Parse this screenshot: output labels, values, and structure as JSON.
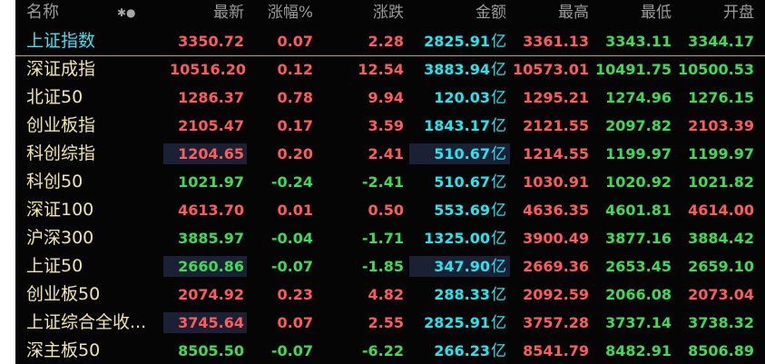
{
  "header": {
    "name": "名称",
    "latest": "最新",
    "pct": "涨幅%",
    "chg": "涨跌",
    "amount": "金额",
    "high": "最高",
    "low": "最低",
    "open": "开盘",
    "settings_icon": "✱●"
  },
  "amount_unit": "亿",
  "colors": {
    "up": "#ff5b5b",
    "down": "#3ddc55",
    "amount": "#1ee8f0",
    "name": "#f1e6a6",
    "selected_name": "#3fe0ef"
  },
  "rows": [
    {
      "name": "上证指数",
      "latest": "3350.72",
      "pct": "0.07",
      "chg": "2.28",
      "amount": "2825.91",
      "high": "3361.13",
      "low": "3343.11",
      "open": "3344.17",
      "c": {
        "latest": "red",
        "pct": "red",
        "chg": "red",
        "high": "red",
        "low": "green",
        "open": "green"
      },
      "hl_latest": false,
      "hl_amt": false,
      "selected": true
    },
    {
      "name": "深证成指",
      "latest": "10516.20",
      "pct": "0.12",
      "chg": "12.54",
      "amount": "3883.94",
      "high": "10573.01",
      "low": "10491.75",
      "open": "10500.53",
      "c": {
        "latest": "red",
        "pct": "red",
        "chg": "red",
        "high": "red",
        "low": "green",
        "open": "green"
      },
      "hl_latest": false,
      "hl_amt": false,
      "selected": false
    },
    {
      "name": "北证50",
      "latest": "1286.37",
      "pct": "0.78",
      "chg": "9.94",
      "amount": "120.03",
      "high": "1295.21",
      "low": "1274.96",
      "open": "1276.15",
      "c": {
        "latest": "red",
        "pct": "red",
        "chg": "red",
        "high": "red",
        "low": "green",
        "open": "green"
      },
      "hl_latest": false,
      "hl_amt": false,
      "selected": false
    },
    {
      "name": "创业板指",
      "latest": "2105.47",
      "pct": "0.17",
      "chg": "3.59",
      "amount": "1843.17",
      "high": "2121.55",
      "low": "2097.82",
      "open": "2103.39",
      "c": {
        "latest": "red",
        "pct": "red",
        "chg": "red",
        "high": "red",
        "low": "green",
        "open": "red"
      },
      "hl_latest": false,
      "hl_amt": false,
      "selected": false
    },
    {
      "name": "科创综指",
      "latest": "1204.65",
      "pct": "0.20",
      "chg": "2.41",
      "amount": "510.67",
      "high": "1214.55",
      "low": "1199.97",
      "open": "1199.97",
      "c": {
        "latest": "red",
        "pct": "red",
        "chg": "red",
        "high": "red",
        "low": "green",
        "open": "green"
      },
      "hl_latest": true,
      "hl_amt": true,
      "selected": false
    },
    {
      "name": "科创50",
      "latest": "1021.97",
      "pct": "-0.24",
      "chg": "-2.41",
      "amount": "510.67",
      "high": "1030.91",
      "low": "1020.92",
      "open": "1021.82",
      "c": {
        "latest": "green",
        "pct": "green",
        "chg": "green",
        "high": "red",
        "low": "green",
        "open": "green"
      },
      "hl_latest": false,
      "hl_amt": false,
      "selected": false
    },
    {
      "name": "深证100",
      "latest": "4613.70",
      "pct": "0.01",
      "chg": "0.50",
      "amount": "553.69",
      "high": "4636.35",
      "low": "4601.81",
      "open": "4614.00",
      "c": {
        "latest": "red",
        "pct": "red",
        "chg": "red",
        "high": "red",
        "low": "green",
        "open": "red"
      },
      "hl_latest": false,
      "hl_amt": false,
      "selected": false
    },
    {
      "name": "沪深300",
      "latest": "3885.97",
      "pct": "-0.04",
      "chg": "-1.71",
      "amount": "1325.00",
      "high": "3900.49",
      "low": "3877.16",
      "open": "3884.42",
      "c": {
        "latest": "green",
        "pct": "green",
        "chg": "green",
        "high": "red",
        "low": "green",
        "open": "green"
      },
      "hl_latest": false,
      "hl_amt": false,
      "selected": false
    },
    {
      "name": "上证50",
      "latest": "2660.86",
      "pct": "-0.07",
      "chg": "-1.85",
      "amount": "347.90",
      "high": "2669.36",
      "low": "2653.45",
      "open": "2659.10",
      "c": {
        "latest": "green",
        "pct": "green",
        "chg": "green",
        "high": "red",
        "low": "green",
        "open": "green"
      },
      "hl_latest": true,
      "hl_amt": true,
      "selected": false
    },
    {
      "name": "创业板50",
      "latest": "2074.92",
      "pct": "0.23",
      "chg": "4.82",
      "amount": "288.33",
      "high": "2092.59",
      "low": "2066.08",
      "open": "2073.04",
      "c": {
        "latest": "red",
        "pct": "red",
        "chg": "red",
        "high": "red",
        "low": "green",
        "open": "red"
      },
      "hl_latest": false,
      "hl_amt": false,
      "selected": false
    },
    {
      "name": "上证综合全收...",
      "latest": "3745.64",
      "pct": "0.07",
      "chg": "2.55",
      "amount": "2825.91",
      "high": "3757.28",
      "low": "3737.14",
      "open": "3738.32",
      "c": {
        "latest": "red",
        "pct": "red",
        "chg": "red",
        "high": "red",
        "low": "green",
        "open": "green"
      },
      "hl_latest": true,
      "hl_amt": false,
      "selected": false
    },
    {
      "name": "深主板50",
      "latest": "8505.50",
      "pct": "-0.07",
      "chg": "-6.22",
      "amount": "266.23",
      "high": "8541.79",
      "low": "8482.91",
      "open": "8506.89",
      "c": {
        "latest": "green",
        "pct": "green",
        "chg": "green",
        "high": "red",
        "low": "green",
        "open": "green"
      },
      "hl_latest": false,
      "hl_amt": false,
      "selected": false
    }
  ]
}
